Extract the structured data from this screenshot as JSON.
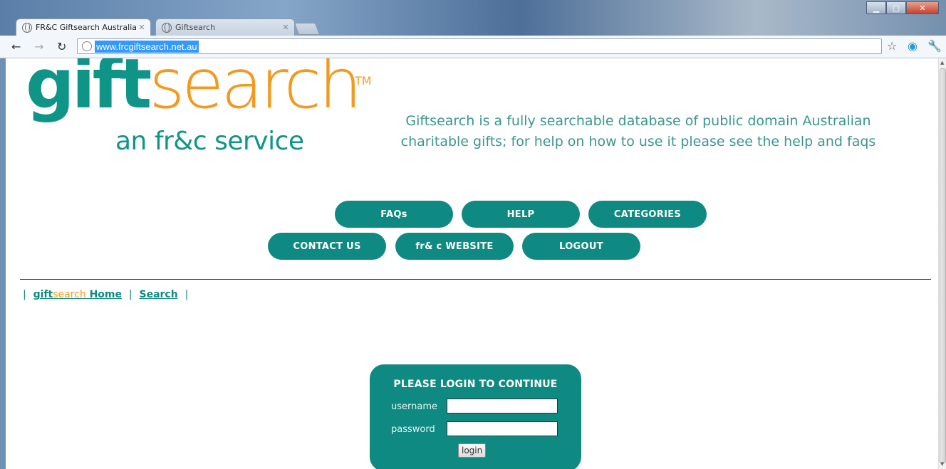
{
  "browser": {
    "tabs": [
      {
        "title": "FR&C Giftsearch Australian"
      },
      {
        "title": "Giftsearch"
      }
    ],
    "url": "www.frcgiftsearch.net.au"
  },
  "logo": {
    "gift": "gift",
    "search": "search",
    "tm": "TM",
    "subtitle": "an fr&c service"
  },
  "intro": "Giftsearch is a fully searchable database of public domain Australian charitable gifts; for help on how to use it please see the help and faqs",
  "nav": {
    "row1": [
      "FAQs",
      "HELP",
      "CATEGORIES"
    ],
    "row2": [
      "CONTACT US",
      "fr& c WEBSITE",
      "LOGOUT"
    ]
  },
  "breadcrumb": {
    "gift": "gift",
    "search": "search",
    "home": " Home",
    "search_link": "Search"
  },
  "login": {
    "heading": "PLEASE LOGIN TO CONTINUE",
    "username_label": "username",
    "password_label": "password",
    "username_value": "",
    "password_value": "",
    "button": "login"
  },
  "colors": {
    "brand_teal": "#0f8a82",
    "brand_orange": "#f39a1e"
  }
}
